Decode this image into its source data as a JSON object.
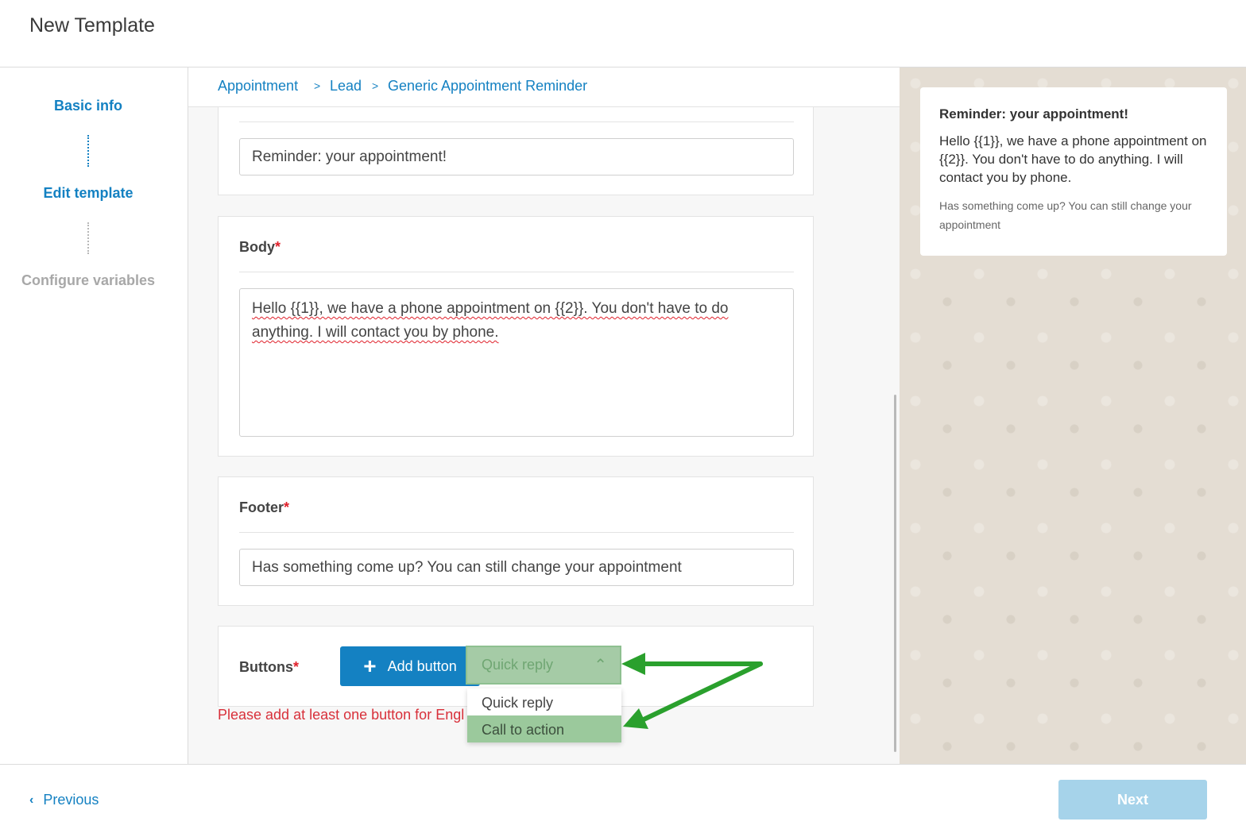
{
  "page": {
    "title": "New Template"
  },
  "steps": [
    {
      "label": "Basic info",
      "state": "active"
    },
    {
      "label": "Edit template",
      "state": "active"
    },
    {
      "label": "Configure variables",
      "state": "inactive"
    }
  ],
  "breadcrumb": [
    "Appointment",
    "Lead",
    "Generic Appointment Reminder"
  ],
  "breadcrumb_separator": ">",
  "header_section": {
    "value": "Reminder: your appointment!"
  },
  "body_section": {
    "label": "Body",
    "required_mark": "*",
    "value": "Hello {{1}}, we have a phone appointment on {{2}}. You don't have to do anything. I will contact you by phone."
  },
  "footer_section": {
    "label": "Footer",
    "required_mark": "*",
    "value": "Has something come up? You can still change your appointment"
  },
  "buttons_section": {
    "label": "Buttons",
    "required_mark": "*",
    "add_label": "Add button",
    "add_icon": "plus-icon",
    "select_value": "Quick reply",
    "select_icon": "chevron-up-icon",
    "options": [
      "Quick reply",
      "Call to action"
    ],
    "highlighted_option": "Call to action",
    "error": "Please add at least one button for Engl"
  },
  "preview": {
    "title": "Reminder: your appointment!",
    "body": "Hello {{1}}, we have a phone appointment on {{2}}. You don't have to do anything. I will contact you by phone.",
    "footer": "Has something come up? You can still change your appointment"
  },
  "nav": {
    "previous_label": "Previous",
    "previous_icon": "chevron-left-icon",
    "next_label": "Next",
    "next_state": "disabled"
  },
  "colors": {
    "accent": "#1481c2",
    "error": "#d8303a",
    "highlight_green": "#9bc99c",
    "annotation_arrow": "#2aa02d",
    "next_disabled": "#a6d3ea"
  }
}
